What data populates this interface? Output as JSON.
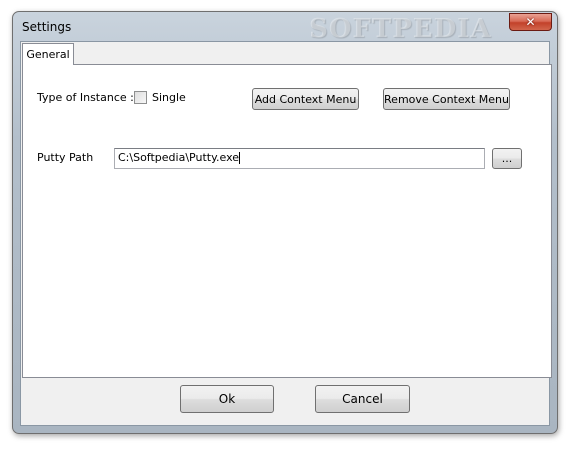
{
  "window": {
    "title": "Settings",
    "watermark": "SOFTPEDIA"
  },
  "tabs": [
    {
      "label": "General"
    }
  ],
  "general": {
    "instance_label": "Type of Instance :",
    "single_label": "Single",
    "single_checked": false,
    "add_context_menu": "Add Context Menu",
    "remove_context_menu": "Remove Context Menu",
    "putty_path_label": "Putty Path",
    "putty_path_value": "C:\\Softpedia\\Putty.exe",
    "browse_label": "..."
  },
  "footer": {
    "ok_label": "Ok",
    "cancel_label": "Cancel"
  }
}
